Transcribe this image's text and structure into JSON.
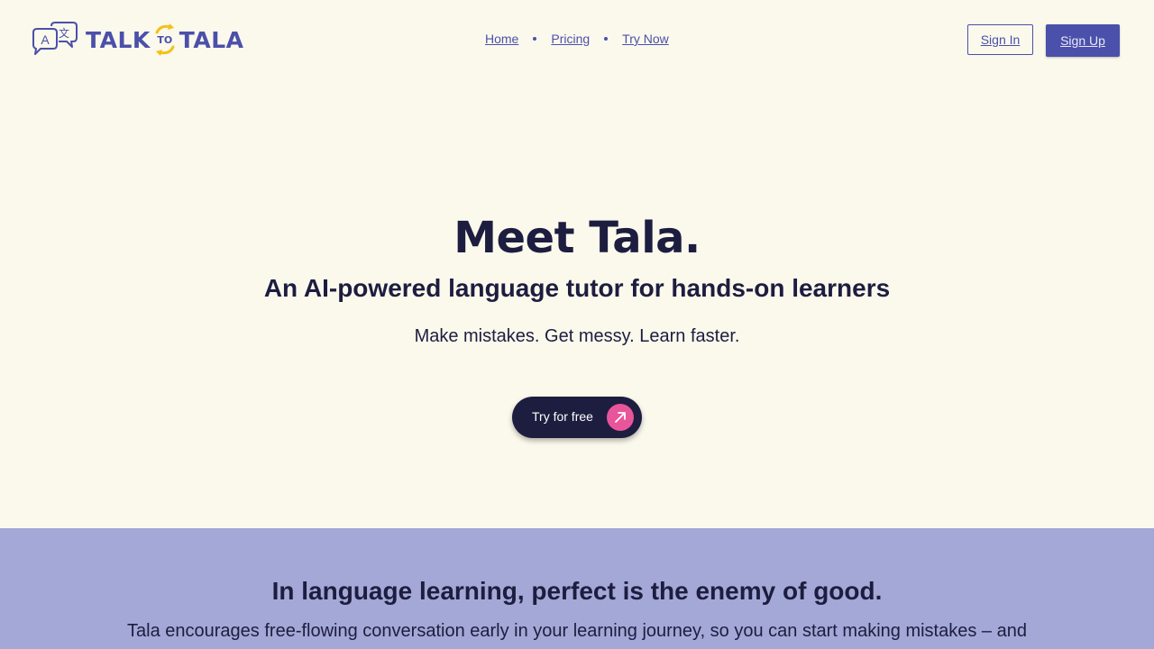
{
  "brand": {
    "talk": "TALK",
    "to": "TO",
    "tala": "TALA"
  },
  "nav": {
    "items": [
      {
        "label": "Home"
      },
      {
        "label": "Pricing"
      },
      {
        "label": "Try Now"
      }
    ]
  },
  "auth": {
    "sign_in": "Sign In",
    "sign_up": "Sign Up"
  },
  "hero": {
    "title": "Meet Tala.",
    "subtitle": "An AI-powered language tutor for hands-on learners",
    "tagline": "Make mistakes. Get messy. Learn faster.",
    "cta_label": "Try for free",
    "cta_icon": "arrow-up-right-icon"
  },
  "feature": {
    "title": "In language learning, perfect is the enemy of good.",
    "body": "Tala encourages free-flowing conversation early in your learning journey, so you can start making mistakes – and"
  },
  "colors": {
    "background": "#fbf9ec",
    "brand": "#4b50aa",
    "navy": "#1d1d40",
    "accent_pink": "#e9559a",
    "accent_yellow": "#f2c21a",
    "feature_bg": "#a3a8d6"
  }
}
